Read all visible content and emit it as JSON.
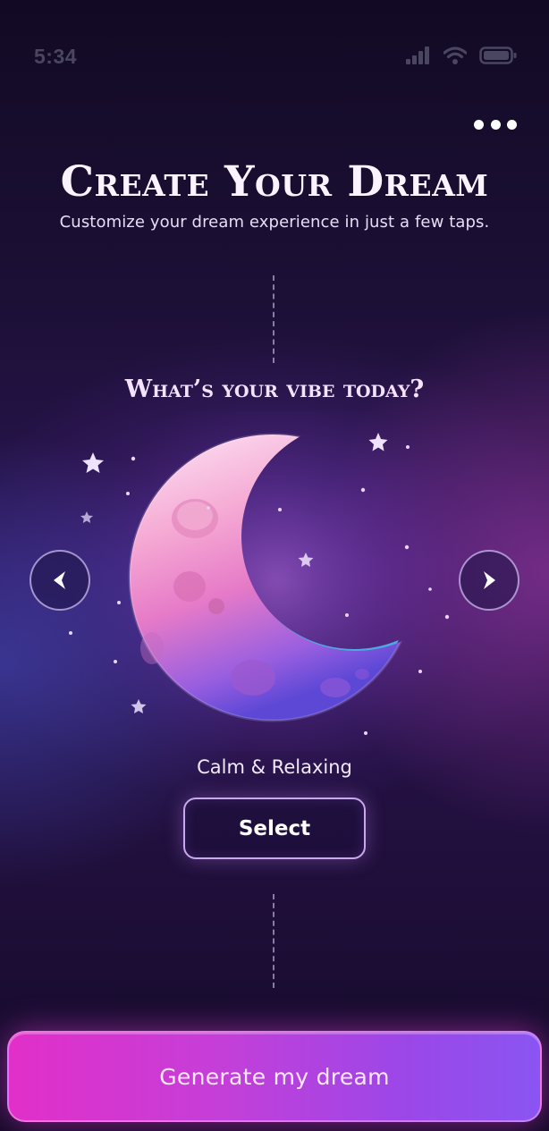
{
  "status_bar": {
    "time": "5:34",
    "icons": [
      "cellular-signal-icon",
      "wifi-icon",
      "battery-icon"
    ]
  },
  "header": {
    "more_icon": "more-horizontal-icon",
    "title": "Create Your Dream",
    "subtitle": "Customize your dream experience in just a few taps."
  },
  "vibe": {
    "question": "What’s your vibe today?",
    "current_label": "Calm & Relaxing",
    "prev_icon": "chevron-left-icon",
    "next_icon": "chevron-right-icon",
    "illustration": "crescent-moon-illustration",
    "select_label": "Select"
  },
  "footer": {
    "generate_label": "Generate my dream"
  },
  "colors": {
    "background_top": "#120a24",
    "background_mid": "#2a1452",
    "accent_pink": "#e22fc9",
    "accent_purple": "#8a55f2",
    "button_border": "#c9a8f0"
  }
}
